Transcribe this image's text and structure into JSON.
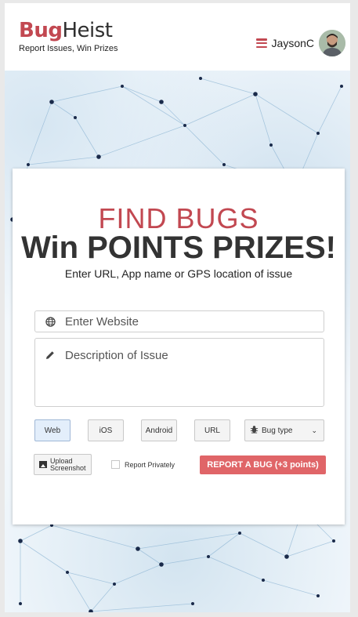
{
  "header": {
    "logo_part1": "Bug",
    "logo_part2": "Heist",
    "tagline": "Report Issues, Win Prizes",
    "username": "JaysonC"
  },
  "hero": {
    "title_line1": "FIND BUGS",
    "title_line2": "Win POINTS PRIZES!",
    "subtitle": "Enter URL, App name or GPS location of issue"
  },
  "form": {
    "website_placeholder": "Enter Website",
    "description_placeholder": "Description of Issue",
    "platform_buttons": [
      "Web",
      "iOS",
      "Android",
      "URL"
    ],
    "active_platform": "Web",
    "bug_type_label": "Bug type",
    "upload_label_line1": "Upload",
    "upload_label_line2": "Screenshot",
    "private_label": "Report Privately",
    "submit_label": "REPORT A BUG (+3 points)"
  },
  "colors": {
    "brand_red": "#c24851",
    "submit_button": "#e06568",
    "network_node": "#1a2a4a"
  },
  "icons": {
    "menu": "hamburger-icon",
    "website": "globe-icon",
    "description": "pencil-icon",
    "bug_type": "bug-icon",
    "upload": "image-icon"
  }
}
